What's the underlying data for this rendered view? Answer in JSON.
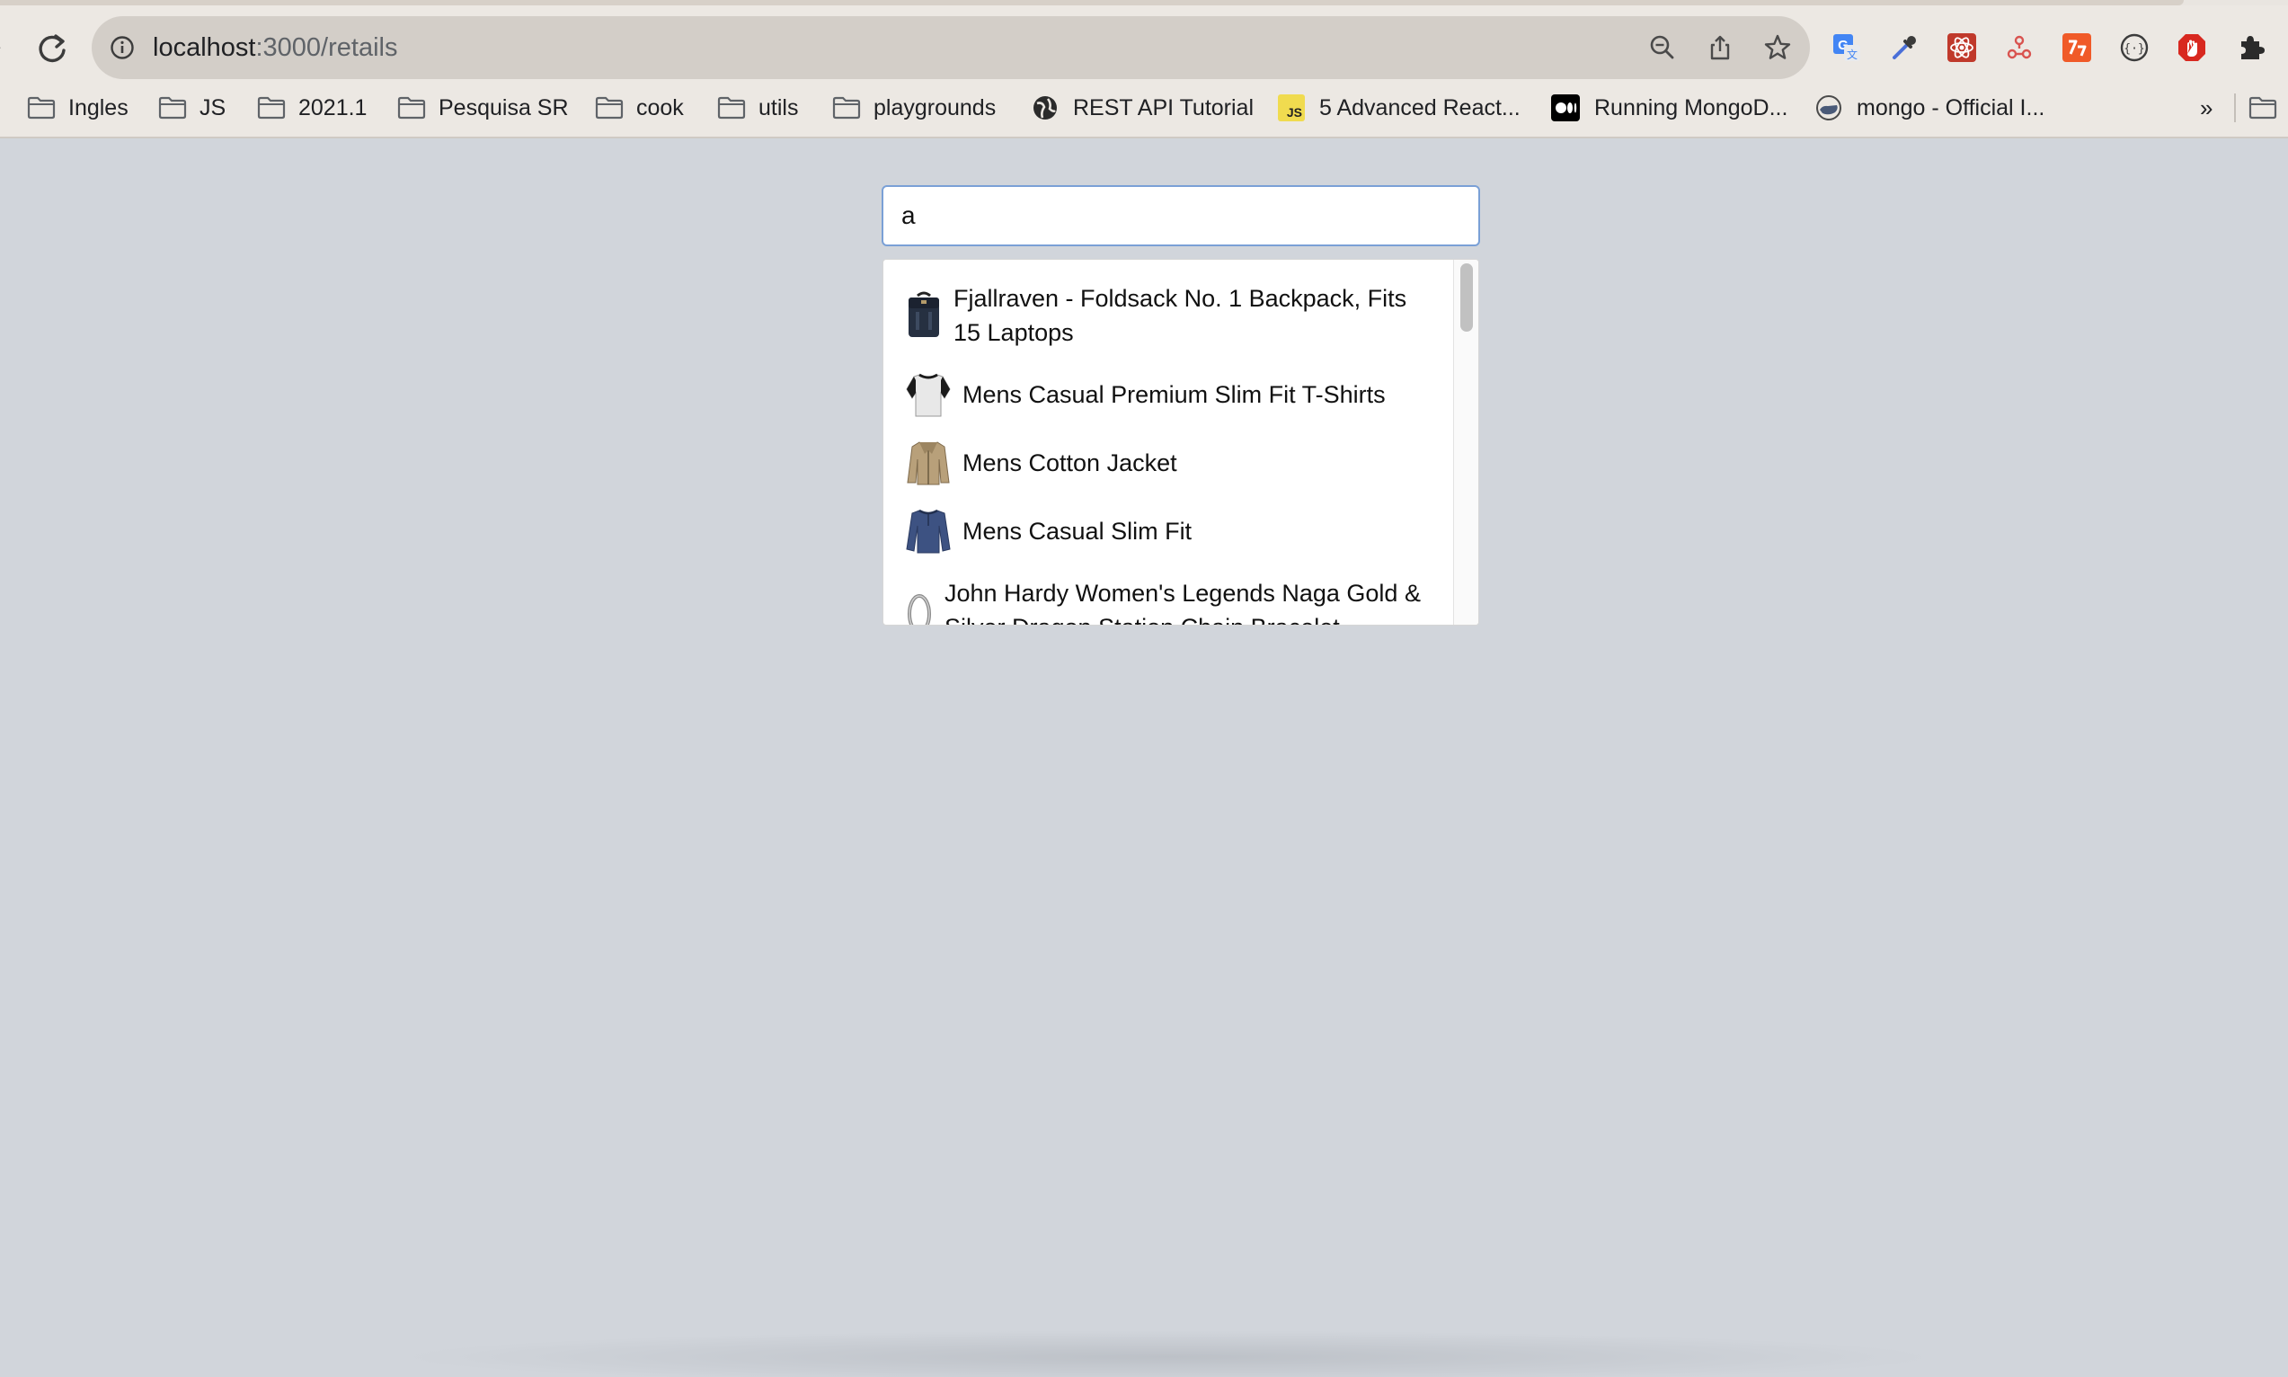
{
  "browser": {
    "url_host": "localhost",
    "url_path": ":3000/retails",
    "toolbar_icons": [
      "zoom-out-icon",
      "share-icon",
      "star-icon"
    ],
    "extensions": [
      "google-translate-icon",
      "color-picker-icon",
      "react-devtools-icon",
      "redux-devtools-icon",
      "postman-icon",
      "json-viewer-icon",
      "adblock-icon",
      "extensions-puzzle-icon"
    ],
    "bookmarks": [
      {
        "label": "Ingles",
        "icon": "folder-icon"
      },
      {
        "label": "JS",
        "icon": "folder-icon"
      },
      {
        "label": "2021.1",
        "icon": "folder-icon"
      },
      {
        "label": "Pesquisa SR",
        "icon": "folder-icon"
      },
      {
        "label": "cook",
        "icon": "folder-icon"
      },
      {
        "label": "utils",
        "icon": "folder-icon"
      },
      {
        "label": "playgrounds",
        "icon": "folder-icon"
      },
      {
        "label": "REST API Tutorial",
        "icon": "globe-icon"
      },
      {
        "label": "5 Advanced React...",
        "icon": "js-icon",
        "icon_text": "JS"
      },
      {
        "label": "Running MongoD...",
        "icon": "medium-icon"
      },
      {
        "label": "mongo - Official I...",
        "icon": "docker-icon"
      }
    ],
    "overflow_label": "»"
  },
  "search": {
    "value": "a",
    "placeholder": ""
  },
  "results": [
    {
      "line1": "Fjallraven - Foldsack No. 1 Backpack, Fits",
      "line2": "15 Laptops",
      "icon": "backpack-icon"
    },
    {
      "line1": "Mens Casual Premium Slim Fit T-Shirts",
      "icon": "tshirt-icon"
    },
    {
      "line1": "Mens Cotton Jacket",
      "icon": "jacket-icon"
    },
    {
      "line1": "Mens Casual Slim Fit",
      "icon": "longsleeve-shirt-icon"
    },
    {
      "line1": "John Hardy Women's Legends Naga Gold &",
      "line2": "Silver Dragon Station Chain Bracelet",
      "icon": "bracelet-icon"
    }
  ],
  "colors": {
    "page_bg": "#d1d5db",
    "chrome_bg": "#ece8e3",
    "input_border": "#7aa0d6"
  }
}
